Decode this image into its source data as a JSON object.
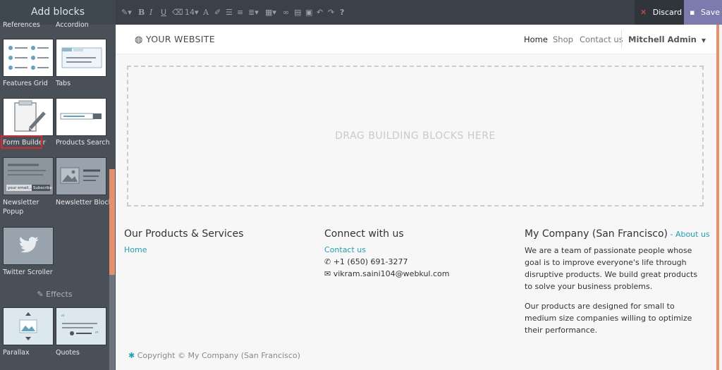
{
  "panel": {
    "title": "Add blocks",
    "cut_labels": [
      "References",
      "Accordion"
    ],
    "blocks": [
      {
        "label": "Features Grid"
      },
      {
        "label": "Tabs"
      },
      {
        "label": "Form Builder"
      },
      {
        "label": "Products Search"
      },
      {
        "label": "Newsletter\nPopup"
      },
      {
        "label": "Newsletter Block"
      },
      {
        "label": "Twitter Scroller"
      },
      {
        "label": "Parallax"
      },
      {
        "label": "Quotes"
      }
    ],
    "newsletter_thumb_text": "your email...",
    "newsletter_thumb_button": "Subscribe",
    "effects_label": "Effects"
  },
  "toolbar": {
    "font_size": "14",
    "discard_label": "Discard",
    "save_label": "Save"
  },
  "site": {
    "logo": "YOUR WEBSITE",
    "nav": [
      "Home",
      "Shop",
      "Contact us"
    ],
    "user": "Mitchell Admin",
    "dropzone_text": "DRAG BUILDING BLOCKS HERE",
    "footer": {
      "col1_title": "Our Products & Services",
      "col1_link": "Home",
      "col2_title": "Connect with us",
      "col2_link": "Contact us",
      "phone": "+1 (650) 691-3277",
      "email": "vikram.saini104@webkul.com",
      "col3_title": "My Company (San Francisco)",
      "col3_sep": " - ",
      "col3_link": "About us",
      "col3_p1": "We are a team of passionate people whose goal is to improve everyone's life through disruptive products. We build great products to solve your business problems.",
      "col3_p2": "Our products are designed for small to medium size companies willing to optimize their performance.",
      "copyright": "Copyright © My Company (San Francisco)"
    }
  },
  "colors": {
    "accent": "#21a1b7",
    "save": "#7c7bad",
    "panel": "#495057",
    "highlight": "#d9262f"
  }
}
